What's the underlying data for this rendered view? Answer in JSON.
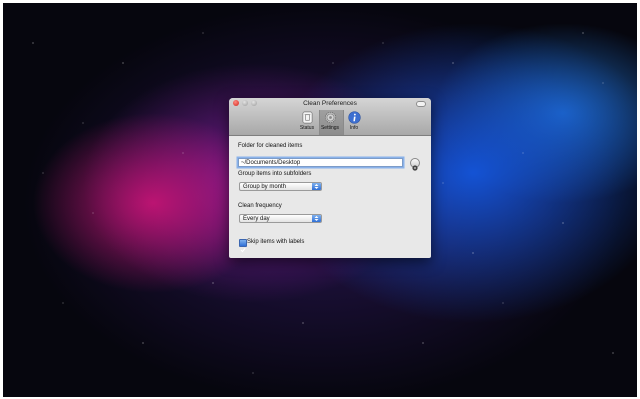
{
  "window": {
    "title": "Clean Preferences"
  },
  "toolbar": {
    "items": [
      {
        "label": "Status",
        "icon": "trash-icon"
      },
      {
        "label": "Settings",
        "icon": "gear-icon"
      },
      {
        "label": "Info",
        "icon": "info-icon"
      }
    ],
    "selected": "Settings"
  },
  "settings": {
    "folder_label": "Folder for cleaned items",
    "folder_value": "~/Documents/Desktop",
    "group_label": "Group items into subfolders",
    "group_value": "Group by month",
    "frequency_label": "Clean frequency",
    "frequency_value": "Every day",
    "skip_label": "Skip items with labels",
    "skip_checked": true
  },
  "colors": {
    "accent": "#2f6fd6",
    "close_button": "#d0241c"
  }
}
